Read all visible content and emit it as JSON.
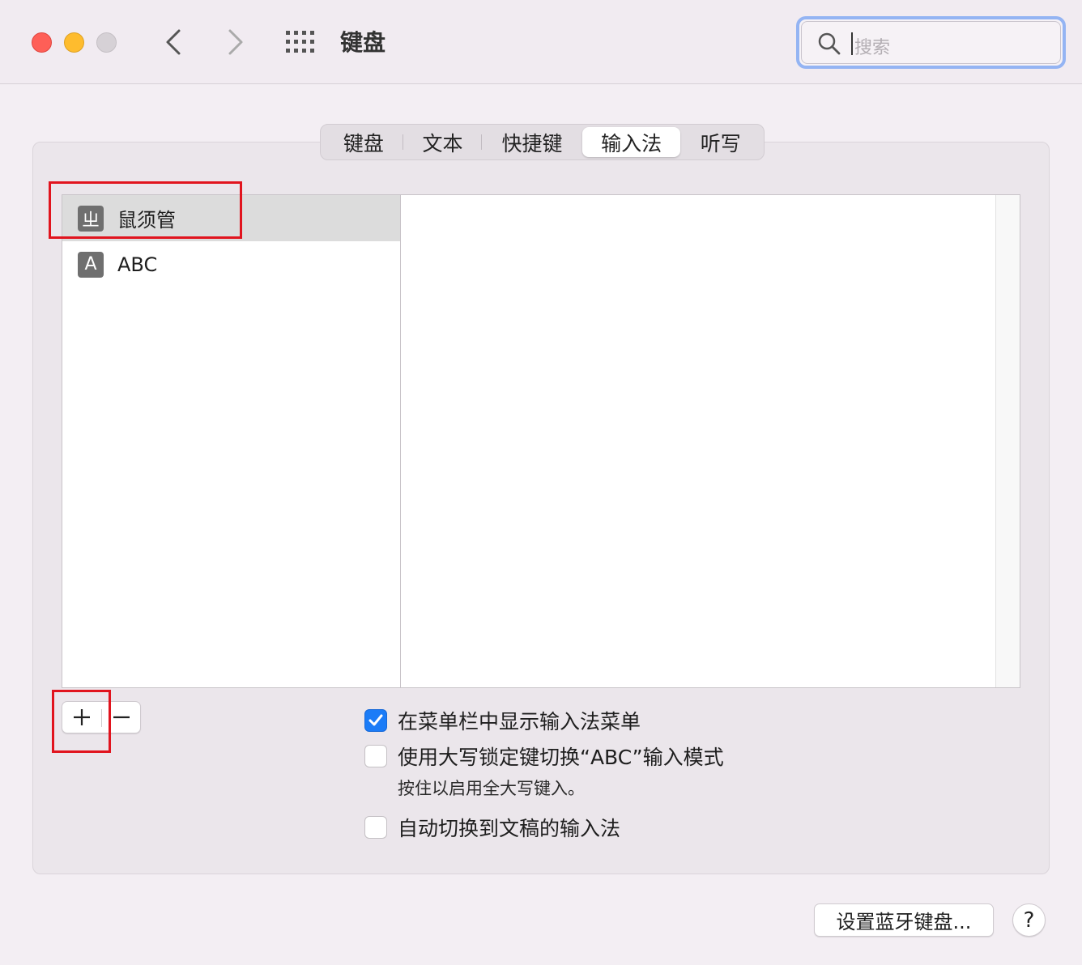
{
  "window": {
    "title": "键盘"
  },
  "search": {
    "placeholder": "搜索"
  },
  "tabs": [
    {
      "label": "键盘"
    },
    {
      "label": "文本"
    },
    {
      "label": "快捷键"
    },
    {
      "label": "输入法",
      "active": true
    },
    {
      "label": "听写"
    }
  ],
  "input_sources": [
    {
      "icon_text": "ㄓ",
      "icon_name": "bopomofo-icon",
      "label": "鼠须管",
      "selected": true
    },
    {
      "icon_text": "A",
      "icon_name": "abc-input-icon",
      "label": "ABC",
      "selected": false
    }
  ],
  "controls": {
    "add": "+",
    "remove": "−"
  },
  "options": [
    {
      "label": "在菜单栏中显示输入法菜单",
      "checked": true
    },
    {
      "label": "使用大写锁定键切换“ABC”输入模式",
      "checked": false
    },
    {
      "label": "自动切换到文稿的输入法",
      "checked": false
    }
  ],
  "hint": "按住以启用全大写键入。",
  "buttons": {
    "bluetooth": "设置蓝牙键盘...",
    "help": "?"
  },
  "colors": {
    "accent": "#1b7cf7",
    "annotation": "#e1141e"
  }
}
